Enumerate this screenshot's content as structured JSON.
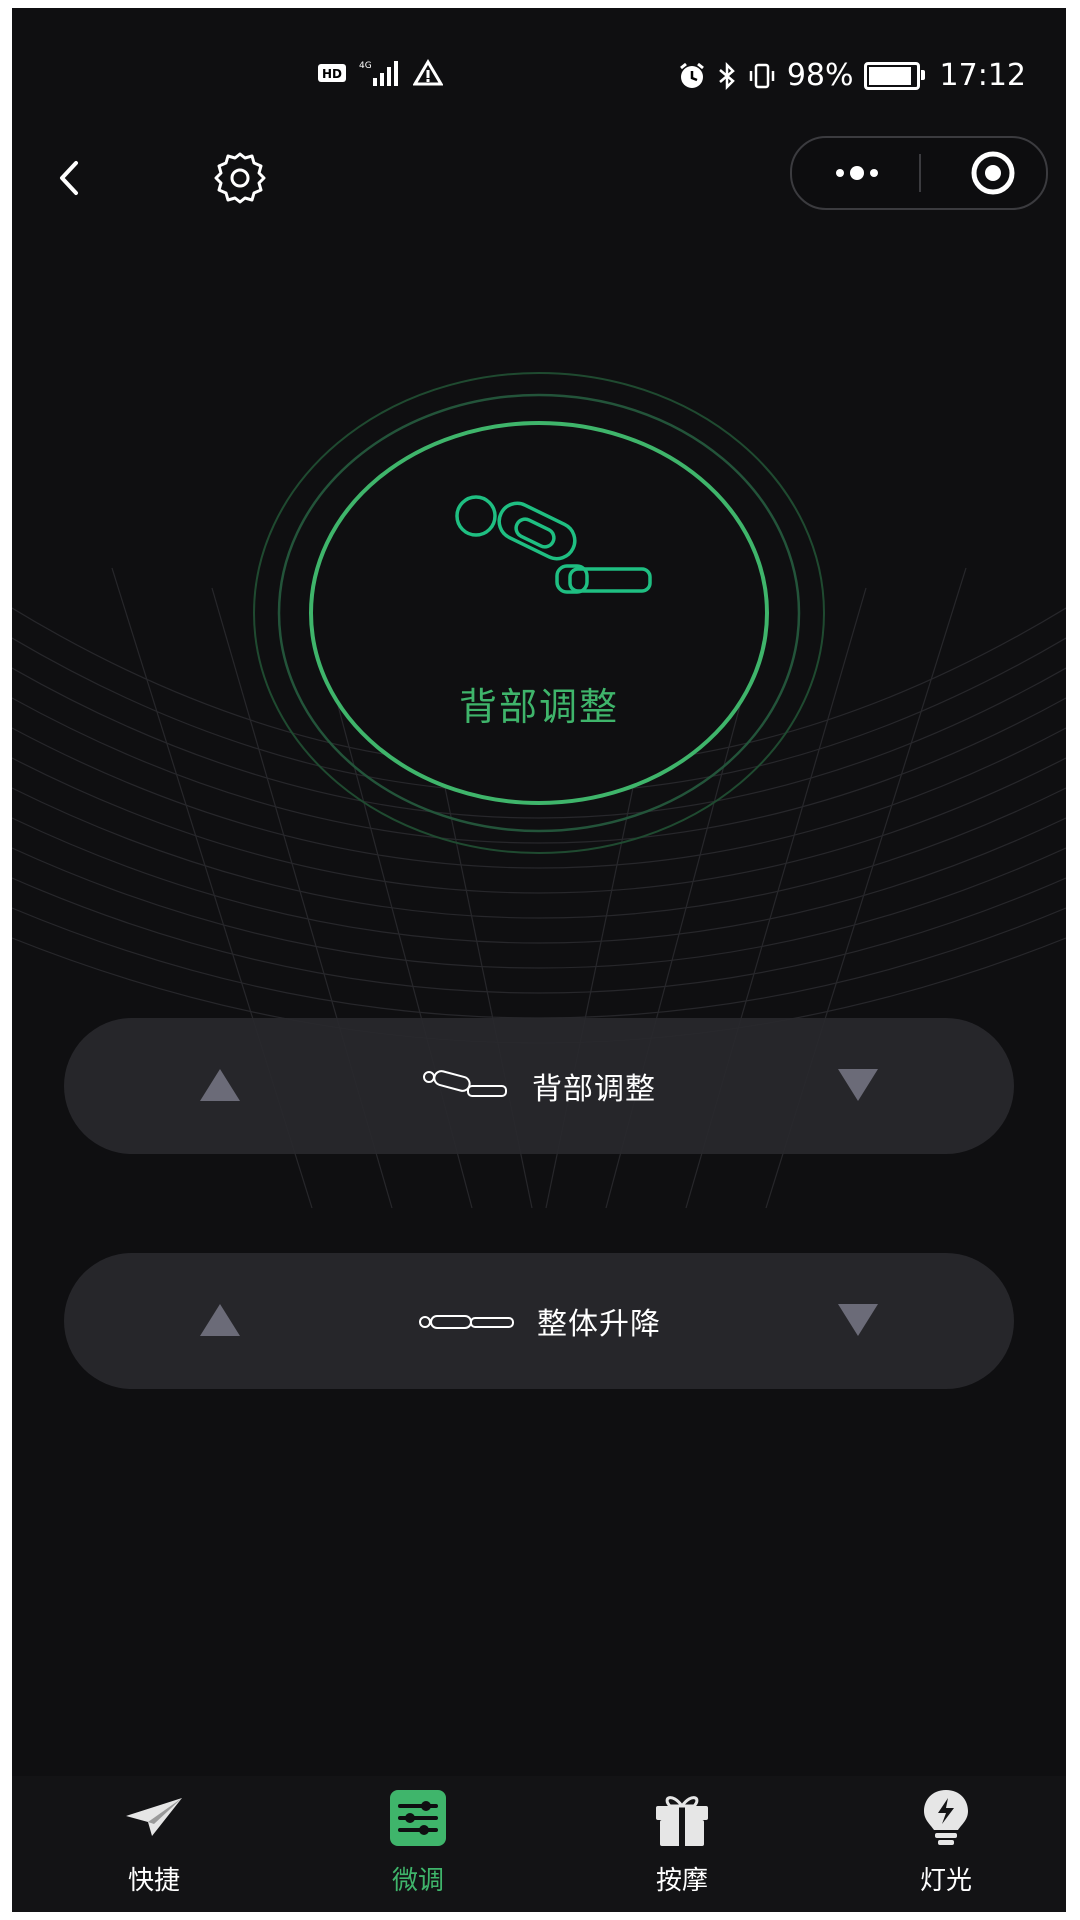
{
  "status_bar": {
    "network_left": "HD 4G",
    "battery_percent": "98%",
    "time": "17:12"
  },
  "nav": {
    "back_icon": "chevron-left-icon",
    "settings_icon": "gear-icon",
    "capsule_more_icon": "more-dots-icon",
    "capsule_close_icon": "target-circle-icon"
  },
  "hero": {
    "label": "背部调整",
    "accent_color": "#3fb56b",
    "icon": "bed-back-icon"
  },
  "controls": [
    {
      "label": "背部调整",
      "icon": "bed-back-small-icon",
      "up_icon": "triangle-up-icon",
      "down_icon": "triangle-down-icon"
    },
    {
      "label": "整体升降",
      "icon": "bed-flat-small-icon",
      "up_icon": "triangle-up-icon",
      "down_icon": "triangle-down-icon"
    }
  ],
  "tabbar": {
    "tabs": [
      {
        "label": "快捷",
        "icon": "paper-plane-icon",
        "active": false
      },
      {
        "label": "微调",
        "icon": "sliders-icon",
        "active": true
      },
      {
        "label": "按摩",
        "icon": "gift-icon",
        "active": false
      },
      {
        "label": "灯光",
        "icon": "lightbulb-icon",
        "active": false
      }
    ]
  }
}
